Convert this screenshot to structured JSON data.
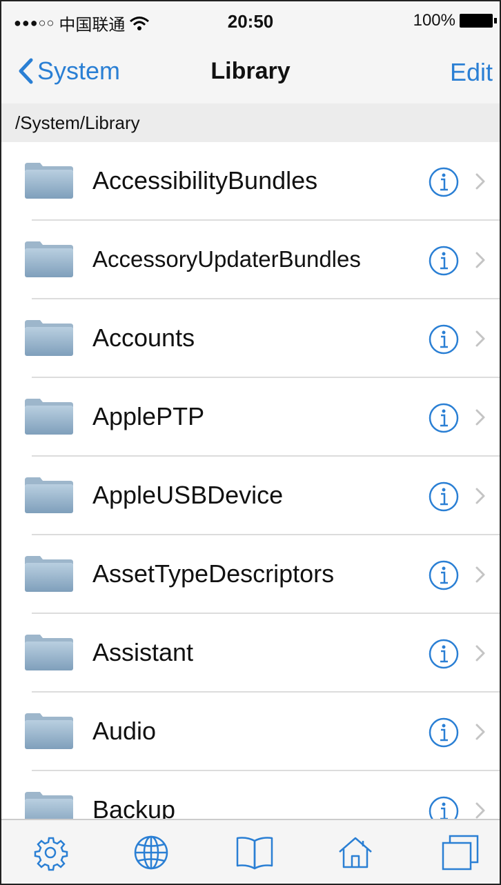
{
  "status_bar": {
    "signal": "●●●○○",
    "carrier": "中国联通",
    "time": "20:50",
    "battery": "100%"
  },
  "nav": {
    "back_label": "System",
    "title": "Library",
    "edit_label": "Edit"
  },
  "path": "/System/Library",
  "items": [
    {
      "label": "AccessibilityBundles"
    },
    {
      "label": "AccessoryUpdaterBundles"
    },
    {
      "label": "Accounts"
    },
    {
      "label": "ApplePTP"
    },
    {
      "label": "AppleUSBDevice"
    },
    {
      "label": "AssetTypeDescriptors"
    },
    {
      "label": "Assistant"
    },
    {
      "label": "Audio"
    },
    {
      "label": "Backup"
    }
  ],
  "toolbar": {
    "icons": [
      "gear-icon",
      "globe-icon",
      "book-icon",
      "home-icon",
      "windows-icon"
    ]
  },
  "colors": {
    "accent": "#2a7fd4",
    "folder": "#8fb0cc"
  }
}
